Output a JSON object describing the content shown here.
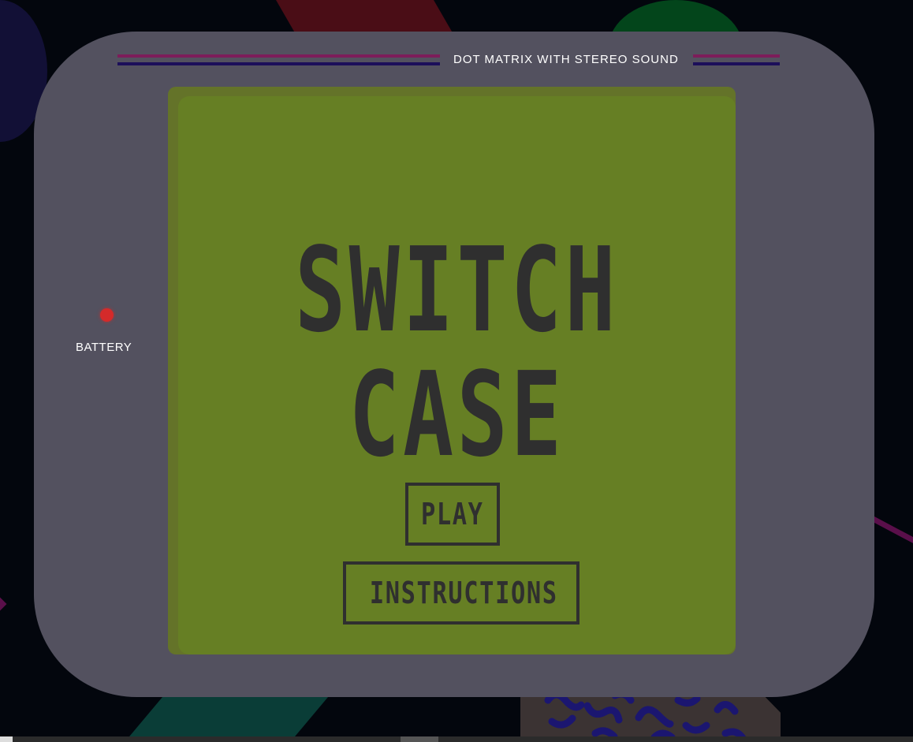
{
  "console": {
    "header_title": "DOT MATRIX WITH STEREO SOUND",
    "battery_label": "BATTERY"
  },
  "screen": {
    "title_line1": "SWITCH",
    "title_line2": "CASE",
    "menu": {
      "play_label": "PLAY",
      "instructions_label": "INSTRUCTIONS"
    }
  },
  "colors": {
    "background": "#03060d",
    "console_body": "#53515f",
    "screen_outer": "#647329",
    "screen_inner": "#667f24",
    "screen_ink": "#2f2f2f",
    "header_stripe_magenta": "#7d1d5a",
    "header_stripe_indigo": "#1c0f5a",
    "battery_led": "#d42a2a"
  },
  "icons": {
    "battery_indicator": "battery-led-icon"
  }
}
